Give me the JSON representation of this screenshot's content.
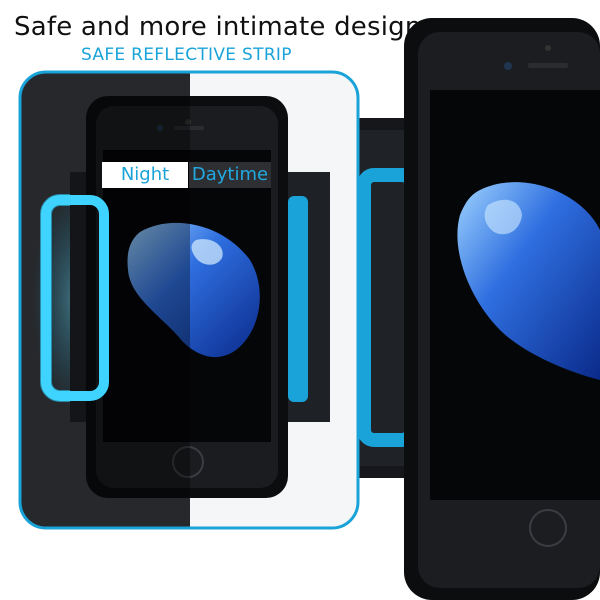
{
  "headline": "Safe and more intimate design",
  "subline": "SAFE REFLECTIVE STRIP",
  "toggle": {
    "night": "Night",
    "day": "Daytime"
  },
  "colors": {
    "accent": "#1aa3d8",
    "glow": "#3fd4ff",
    "phone": "#111316"
  }
}
